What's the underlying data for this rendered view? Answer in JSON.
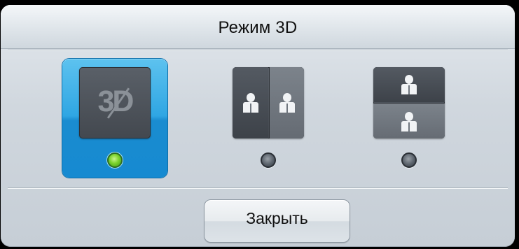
{
  "dialog": {
    "title": "Режим 3D"
  },
  "modes": [
    {
      "id": "3d-off",
      "icon": "3d-off-icon",
      "icon_text": "3D",
      "selected": true,
      "indicator": "green"
    },
    {
      "id": "side-by-side",
      "icon": "side-by-side-icon",
      "selected": false,
      "indicator": "gray"
    },
    {
      "id": "top-bottom",
      "icon": "top-bottom-icon",
      "selected": false,
      "indicator": "gray"
    }
  ],
  "buttons": {
    "close_label": "Закрыть"
  },
  "colors": {
    "selected_accent": "#2fa6e3",
    "indicator_on": "#7bd22d",
    "indicator_off": "#59616a"
  }
}
